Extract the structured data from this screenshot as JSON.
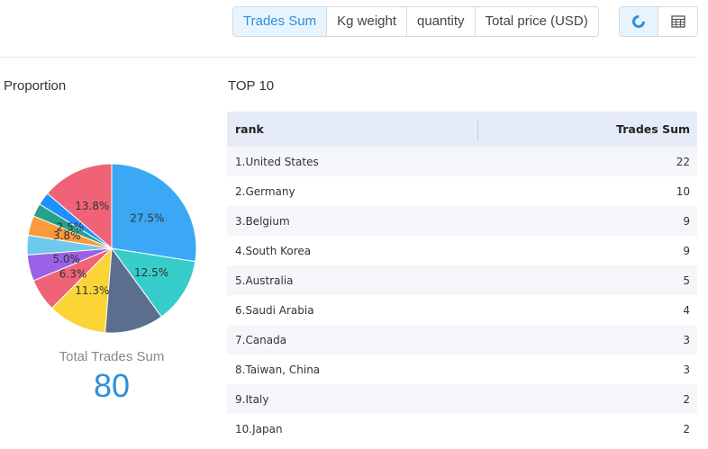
{
  "toolbar": {
    "metric_tabs": [
      "Trades Sum",
      "Kg weight",
      "quantity",
      "Total price (USD)"
    ],
    "active_tab_index": 0,
    "view_buttons": [
      {
        "icon": "pie-chart-icon",
        "active": true
      },
      {
        "icon": "table-icon",
        "active": false
      }
    ]
  },
  "proportion": {
    "title": "Proportion",
    "total_label": "Total Trades Sum",
    "total_value": "80"
  },
  "chart_data": {
    "type": "pie",
    "title": "",
    "slices": [
      {
        "label": "27.5%",
        "value": 22,
        "color": "#3ba8f5"
      },
      {
        "label": "12.5%",
        "value": 10,
        "color": "#36ccc9"
      },
      {
        "label": "",
        "value": 9,
        "color": "#5b6e8e"
      },
      {
        "label": "11.3%",
        "value": 9,
        "color": "#fbd436"
      },
      {
        "label": "6.3%",
        "value": 5,
        "color": "#f06377"
      },
      {
        "label": "5.0%",
        "value": 4,
        "color": "#9a62e6"
      },
      {
        "label": "",
        "value": 3,
        "color": "#6ec9ec"
      },
      {
        "label": "3.8%",
        "value": 3,
        "color": "#fa9a3b"
      },
      {
        "label": "2.5%",
        "value": 2,
        "color": "#27a188"
      },
      {
        "label": "",
        "value": 2,
        "color": "#1e90ff"
      },
      {
        "label": "13.8%",
        "value": 11,
        "color": "#f06377"
      }
    ]
  },
  "top10": {
    "title": "TOP 10",
    "headers": {
      "rank": "rank",
      "value": "Trades Sum"
    },
    "rows": [
      {
        "rank": "1.United States",
        "value": "22"
      },
      {
        "rank": "2.Germany",
        "value": "10"
      },
      {
        "rank": "3.Belgium",
        "value": "9"
      },
      {
        "rank": "4.South Korea",
        "value": "9"
      },
      {
        "rank": "5.Australia",
        "value": "5"
      },
      {
        "rank": "6.Saudi Arabia",
        "value": "4"
      },
      {
        "rank": "7.Canada",
        "value": "3"
      },
      {
        "rank": "8.Taiwan, China",
        "value": "3"
      },
      {
        "rank": "9.Italy",
        "value": "2"
      },
      {
        "rank": "10.Japan",
        "value": "2"
      }
    ]
  },
  "colors": {
    "accent": "#2f8fd8",
    "active_bg": "#e6f4ff",
    "table_header_bg": "#e6ecf7",
    "row_alt_bg": "#f5f6f9"
  }
}
